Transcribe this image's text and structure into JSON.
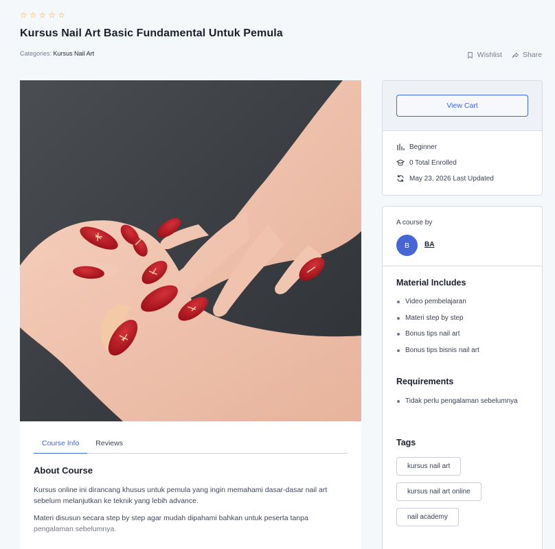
{
  "rating": {
    "stars": [
      "☆",
      "☆",
      "☆",
      "☆",
      "☆"
    ]
  },
  "course": {
    "title": "Kursus Nail Art Basic Fundamental Untuk Pemula",
    "categories_label": "Categories:",
    "category": "Kursus Nail Art"
  },
  "actions": {
    "wishlist": "Wishlist",
    "share": "Share"
  },
  "tabs": [
    "Course Info",
    "Reviews"
  ],
  "about": {
    "title": "About Course",
    "paragraphs": [
      "Kursus online ini dirancang khusus untuk pemula yang ingin memahami dasar-dasar nail art sebelum melanjutkan ke teknik yang lebih advance.",
      "Materi disusun secara step by step agar mudah dipahami bahkan untuk peserta tanpa pengalaman sebelumnya."
    ]
  },
  "sidebar": {
    "view_cart": "View Cart",
    "level": "Beginner",
    "enrolled": "0 Total Enrolled",
    "updated": "May 23, 2026 Last Updated",
    "course_by": "A course by",
    "avatar_initial": "B",
    "author": "BA",
    "material_title": "Material Includes",
    "materials": [
      "Video pembelajaran",
      "Materi step by step",
      "Bonus tips nail art",
      "Bonus tips bisnis nail art"
    ],
    "requirements_title": "Requirements",
    "requirements": [
      "Tidak perlu pengalaman sebelumnya"
    ],
    "tags_title": "Tags",
    "tags": [
      "kursus nail art",
      "kursus nail art online",
      "nail academy"
    ]
  },
  "colors": {
    "accent": "#3e64de",
    "star": "#e8a33d",
    "nail_red": "#b3141c"
  }
}
